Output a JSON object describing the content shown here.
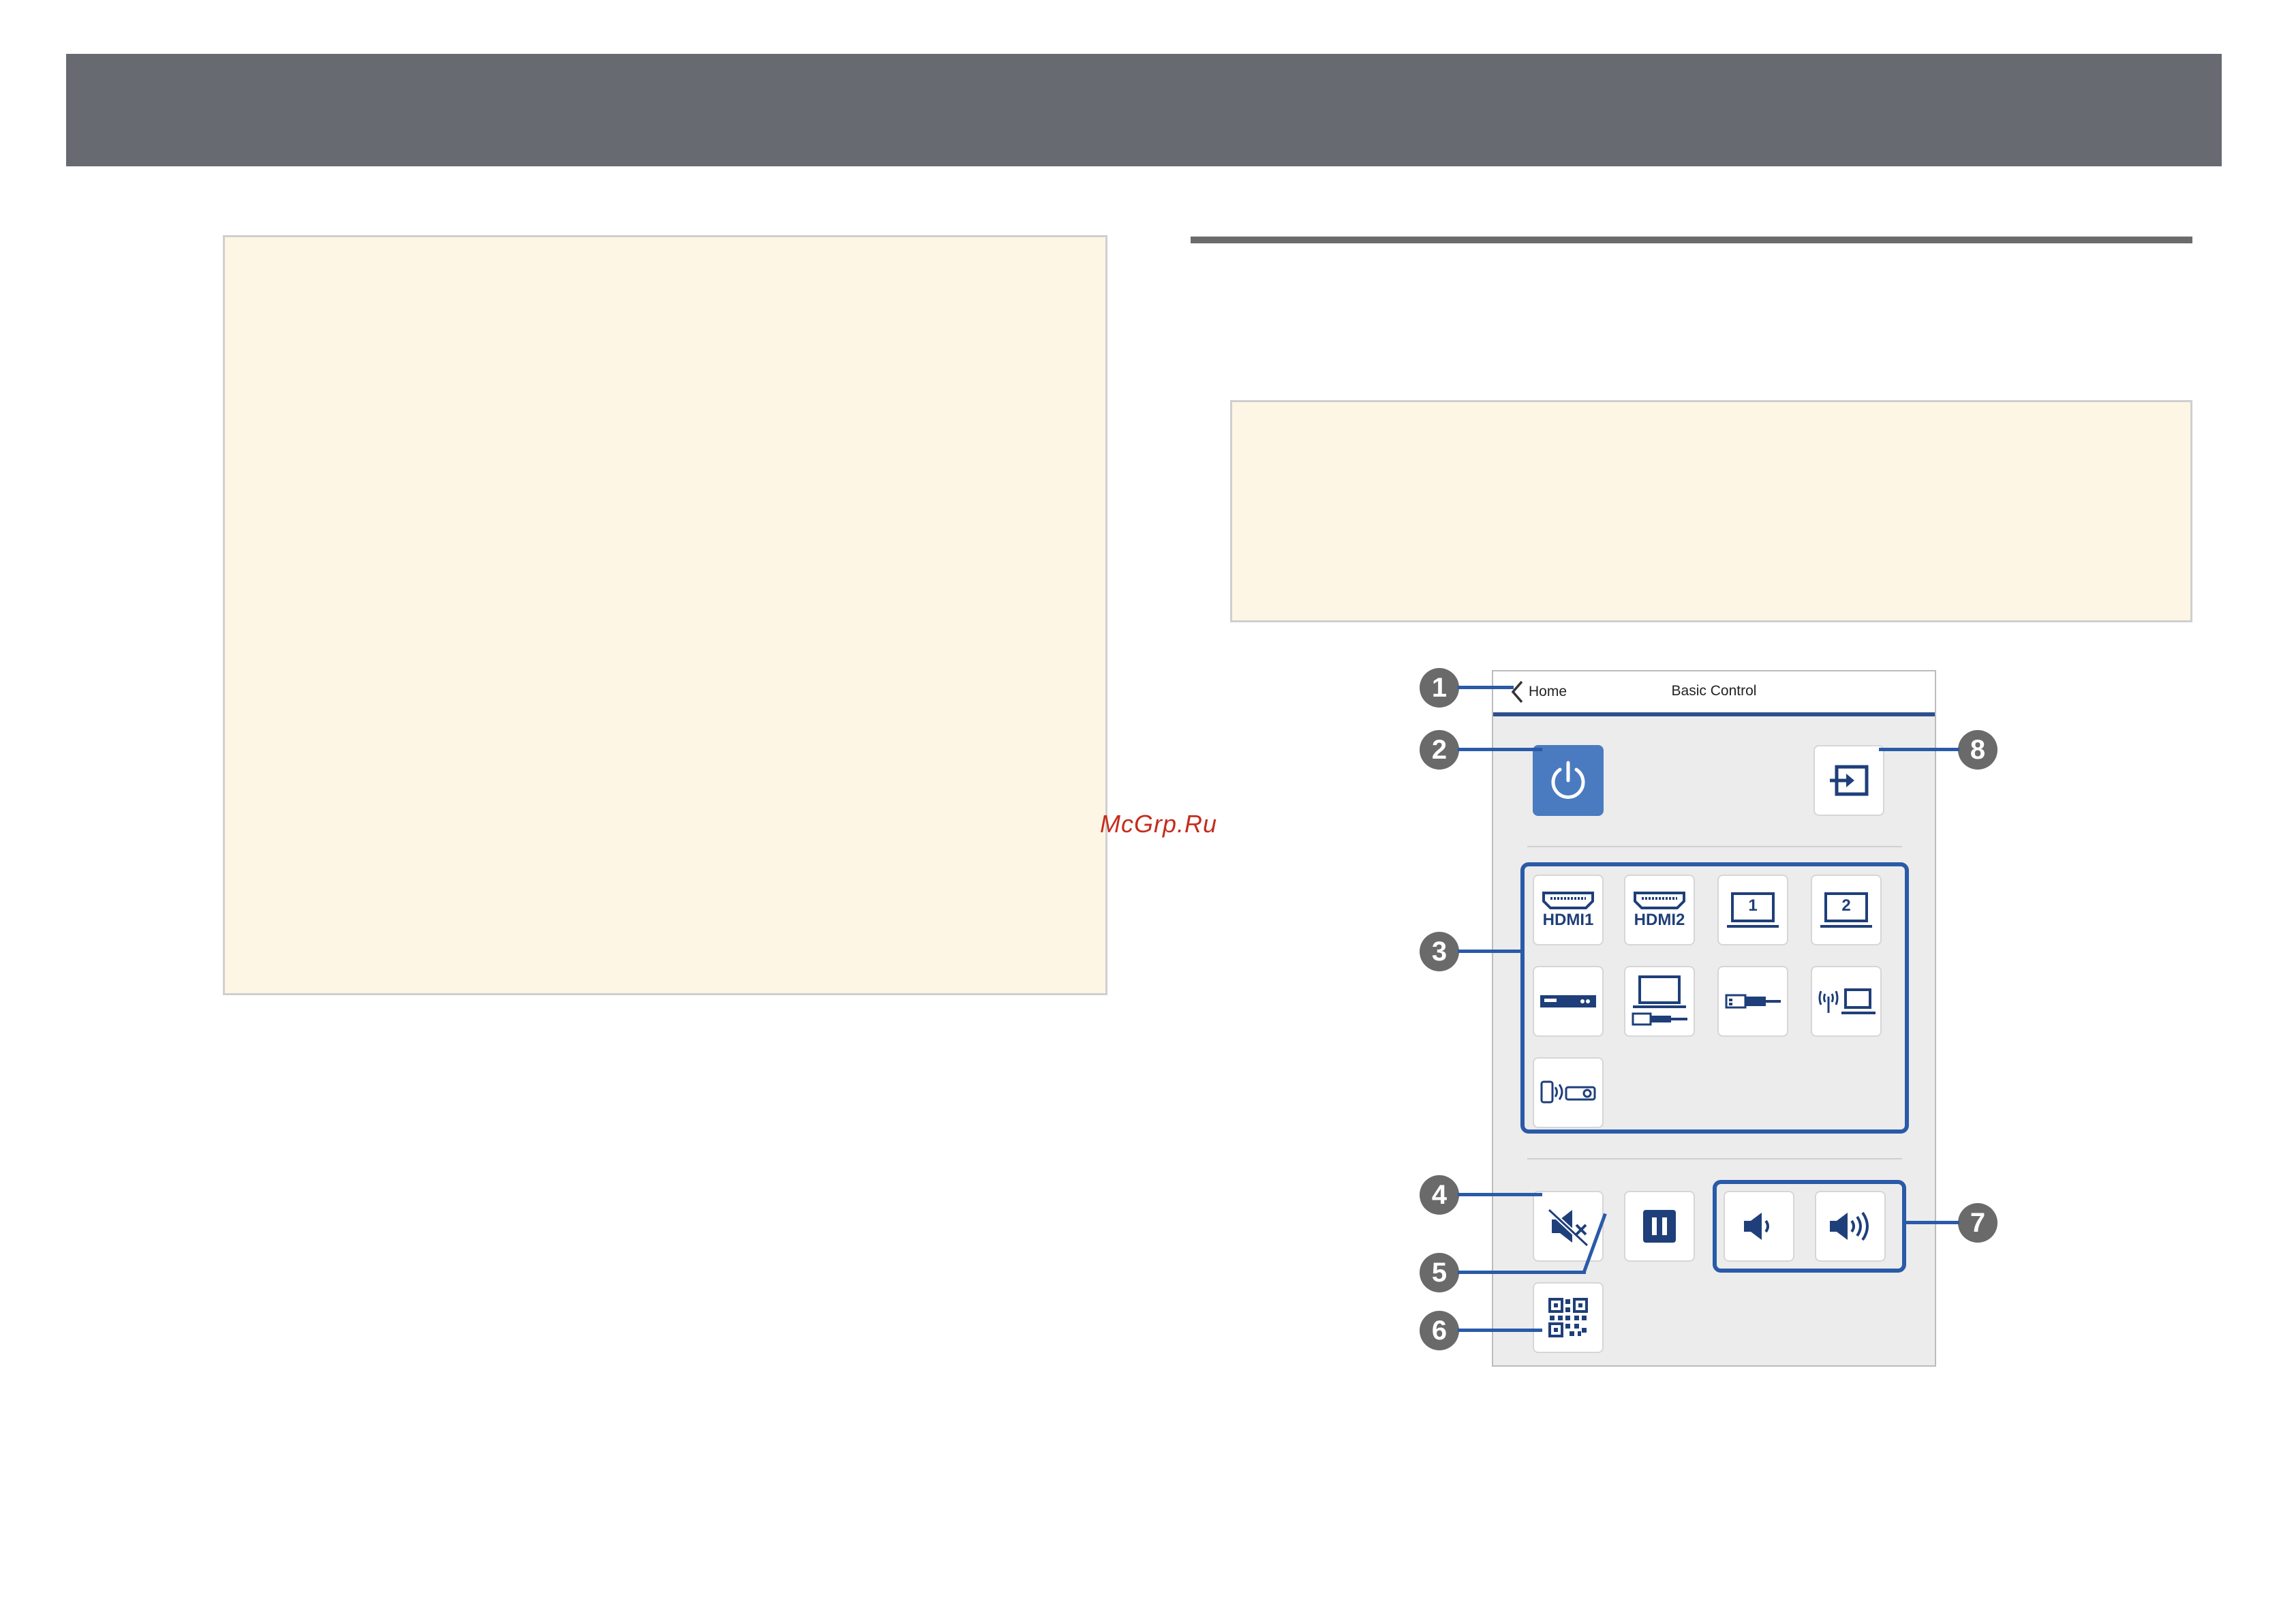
{
  "phone": {
    "header": {
      "back_label": "Home",
      "title": "Basic Control"
    },
    "inputs": [
      {
        "label": "HDMI1",
        "icon": "hdmi-icon"
      },
      {
        "label": "HDMI2",
        "icon": "hdmi-icon"
      },
      {
        "label": "1",
        "icon": "computer-1-icon"
      },
      {
        "label": "2",
        "icon": "computer-2-icon"
      },
      {
        "label": "",
        "icon": "video-player-icon"
      },
      {
        "label": "",
        "icon": "usb-display-icon"
      },
      {
        "label": "",
        "icon": "usb-icon"
      },
      {
        "label": "",
        "icon": "network-icon"
      },
      {
        "label": "",
        "icon": "screen-mirroring-icon"
      }
    ]
  },
  "callouts": [
    "1",
    "2",
    "3",
    "4",
    "5",
    "6",
    "7",
    "8"
  ],
  "watermark": "McGrp.Ru",
  "colors": {
    "topbar": "#686a72",
    "note_bg": "#fdf6e5",
    "accent_blue": "#2a5aa8",
    "power_blue": "#4a7bc0"
  }
}
